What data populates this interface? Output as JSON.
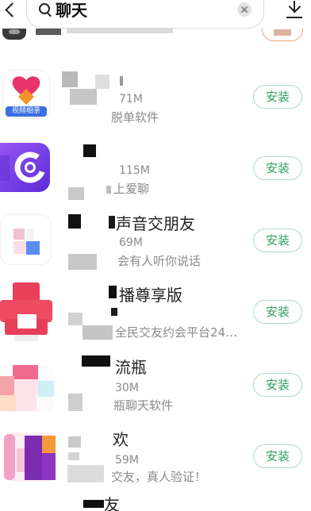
{
  "header": {
    "search_query": "聊天"
  },
  "icons": {
    "back": "back-arrow-icon",
    "search": "search-icon",
    "clear": "clear-icon",
    "download": "download-icon",
    "app": "app-icon"
  },
  "apps": [
    {
      "icon_label": "视频相亲",
      "size": "71M",
      "desc": "脱单软件",
      "install_label": "安装"
    },
    {
      "size": "115M",
      "desc": "上爱聊",
      "install_label": "安装"
    },
    {
      "name": "声音交朋友",
      "size": "69M",
      "desc": "会有人听你说话",
      "install_label": "安装"
    },
    {
      "name": "播尊享版",
      "desc": "全民交友约会平台24…",
      "install_label": "安装"
    },
    {
      "name": "流瓶",
      "size": "30M",
      "desc": "瓶聊天软件",
      "install_label": "安装"
    },
    {
      "name": "欢",
      "size": "59M",
      "desc": "交友，真人验证！",
      "install_label": "安装"
    },
    {
      "name": "友"
    }
  ],
  "colors": {
    "install_text": "#2f9e5f",
    "install_border": "#aed9c0",
    "text_primary": "#222222",
    "text_secondary": "#8a8a8a",
    "partial_button_border": "#f2a47a"
  }
}
